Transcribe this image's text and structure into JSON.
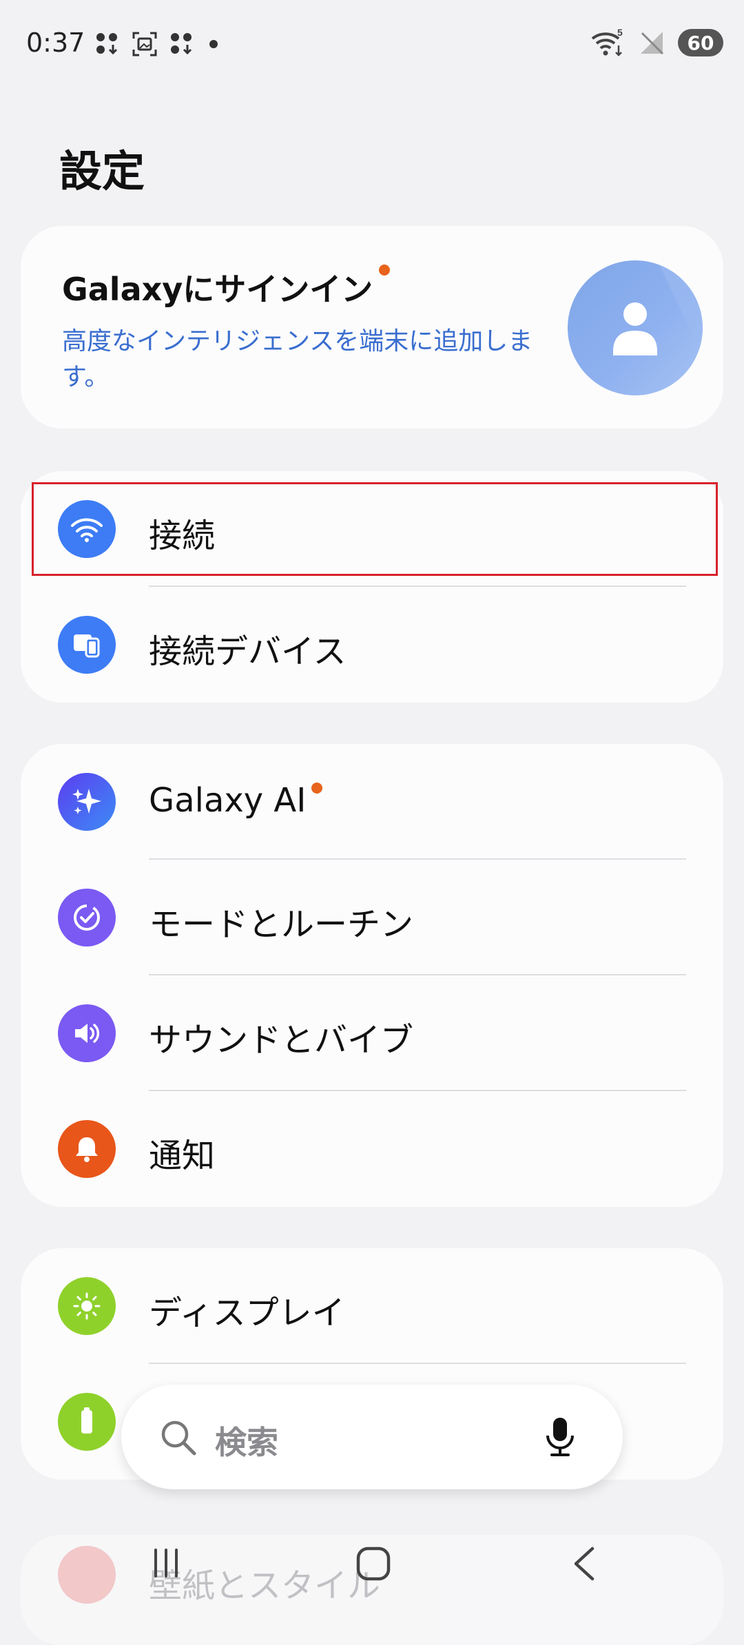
{
  "status_bar": {
    "time": "0:37",
    "battery": "60",
    "wifi_badge": "5"
  },
  "page": {
    "title": "設定"
  },
  "account": {
    "title": "Galaxyにサインイン",
    "subtitle": "高度なインテリジェンスを端末に追加します。"
  },
  "groups": [
    [
      {
        "label": "接続",
        "icon": "wifi-icon",
        "color": "#3d7cf5"
      },
      {
        "label": "接続デバイス",
        "icon": "devices-icon",
        "color": "#3d7cf5"
      }
    ],
    [
      {
        "label": "Galaxy AI",
        "icon": "sparkle-icon",
        "color": "#4a5af0",
        "badge": true
      },
      {
        "label": "モードとルーチン",
        "icon": "routine-check-icon",
        "color": "#7a5af2"
      },
      {
        "label": "サウンドとバイブ",
        "icon": "volume-icon",
        "color": "#7a5af2"
      },
      {
        "label": "通知",
        "icon": "bell-icon",
        "color": "#e8561a"
      }
    ],
    [
      {
        "label": "ディスプレイ",
        "icon": "sun-icon",
        "color": "#8fd12b"
      }
    ]
  ],
  "faded_next_item": "壁紙とスタイル",
  "search": {
    "placeholder": "検索"
  },
  "colors": {
    "accent_blue": "#3d7cf5",
    "badge_orange": "#e8631c",
    "highlight_red": "#d8222b"
  }
}
